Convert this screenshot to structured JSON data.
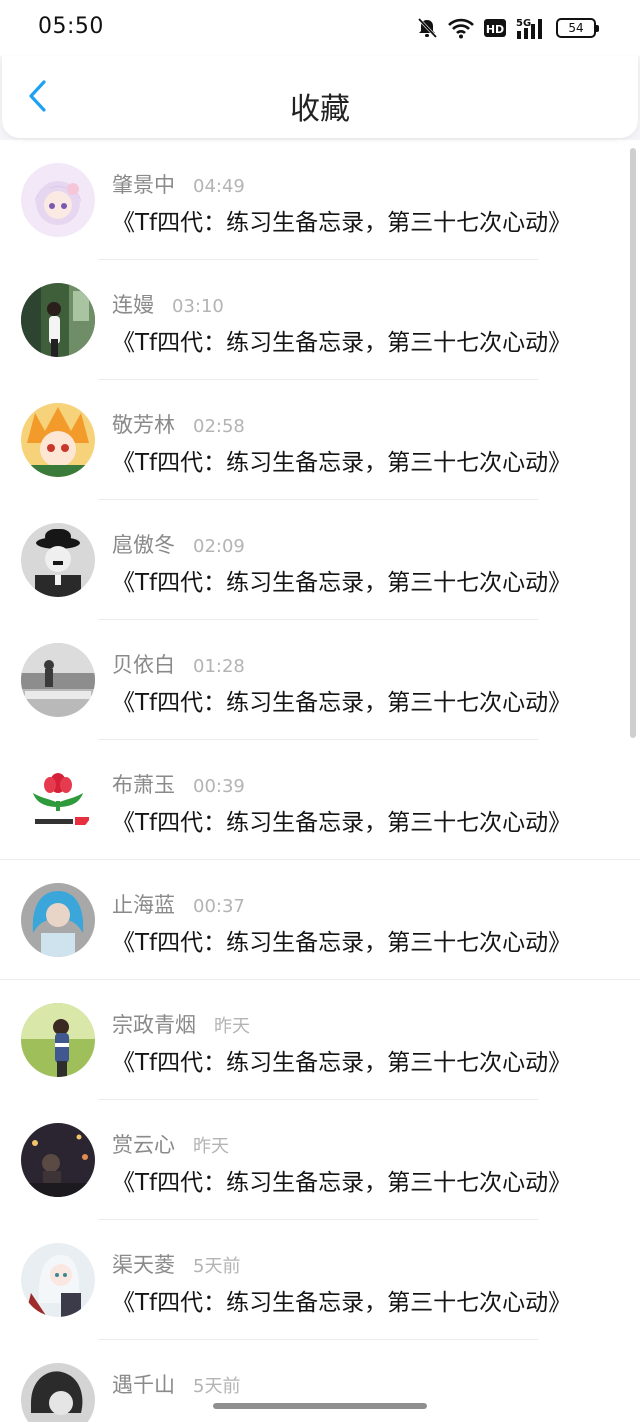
{
  "status_bar": {
    "time": "05:50",
    "icons": [
      "bell-muted-icon",
      "wifi-icon",
      "hd-icon",
      "5g-signal-icon",
      "battery-icon"
    ],
    "network": "5G",
    "hd_label": "HD",
    "battery": "54"
  },
  "header": {
    "back_icon": "chevron-left-icon",
    "title": "收藏",
    "accent_color": "#1ea1f2"
  },
  "favorites": [
    {
      "name": "肇景中",
      "time": "04:49",
      "message": "《Tf四代：练习生备忘录，第三十七次心动》"
    },
    {
      "name": "连嫚",
      "time": "03:10",
      "message": "《Tf四代：练习生备忘录，第三十七次心动》"
    },
    {
      "name": "敬芳林",
      "time": "02:58",
      "message": "《Tf四代：练习生备忘录，第三十七次心动》"
    },
    {
      "name": "扈傲冬",
      "time": "02:09",
      "message": "《Tf四代：练习生备忘录，第三十七次心动》"
    },
    {
      "name": "贝依白",
      "time": "01:28",
      "message": "《Tf四代：练习生备忘录，第三十七次心动》"
    },
    {
      "name": "布萧玉",
      "time": "00:39",
      "message": "《Tf四代：练习生备忘录，第三十七次心动》"
    },
    {
      "name": "止海蓝",
      "time": "00:37",
      "message": "《Tf四代：练习生备忘录，第三十七次心动》"
    },
    {
      "name": "宗政青烟",
      "time": "昨天",
      "message": "《Tf四代：练习生备忘录，第三十七次心动》"
    },
    {
      "name": "赏云心",
      "time": "昨天",
      "message": "《Tf四代：练习生备忘录，第三十七次心动》"
    },
    {
      "name": "渠天菱",
      "time": "5天前",
      "message": "《Tf四代：练习生备忘录，第三十七次心动》"
    },
    {
      "name": "遇千山",
      "time": "5天前",
      "message": ""
    }
  ]
}
